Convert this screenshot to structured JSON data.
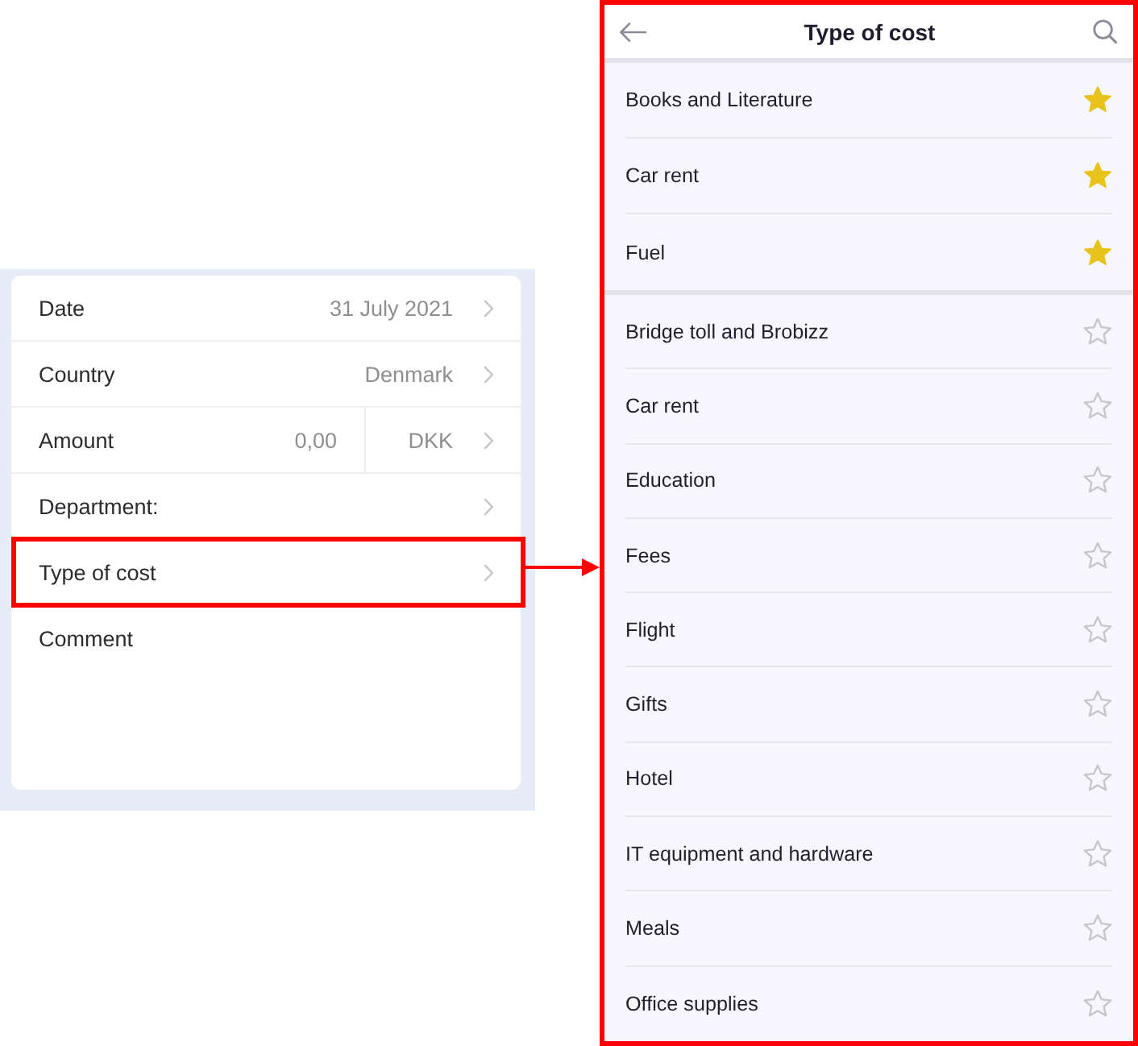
{
  "form": {
    "fields": [
      {
        "kind": "value",
        "label": "Date",
        "value": "31 July 2021",
        "highlighted": false
      },
      {
        "kind": "value",
        "label": "Country",
        "value": "Denmark",
        "highlighted": false
      },
      {
        "kind": "amount",
        "label": "Amount",
        "value": "0,00",
        "currency": "DKK",
        "highlighted": false
      },
      {
        "kind": "value",
        "label": "Department:",
        "highlighted": false
      },
      {
        "kind": "value",
        "label": "Type of cost",
        "highlighted": true
      },
      {
        "kind": "comment",
        "label": "Comment",
        "highlighted": false
      }
    ]
  },
  "connector": {
    "kind": "arrow"
  },
  "picker": {
    "title": "Type of cost",
    "highlighted": true,
    "favorites": [
      {
        "label": "Books and Literature",
        "favorite": true
      },
      {
        "label": "Car rent",
        "favorite": true
      },
      {
        "label": "Fuel",
        "favorite": true
      }
    ],
    "items": [
      {
        "label": "Bridge toll and Brobizz",
        "favorite": false
      },
      {
        "label": "Car rent",
        "favorite": false
      },
      {
        "label": "Education",
        "favorite": false
      },
      {
        "label": "Fees",
        "favorite": false
      },
      {
        "label": "Flight",
        "favorite": false
      },
      {
        "label": "Gifts",
        "favorite": false
      },
      {
        "label": "Hotel",
        "favorite": false
      },
      {
        "label": "IT equipment and hardware",
        "favorite": false
      },
      {
        "label": "Meals",
        "favorite": false
      },
      {
        "label": "Office supplies",
        "favorite": false
      }
    ]
  }
}
